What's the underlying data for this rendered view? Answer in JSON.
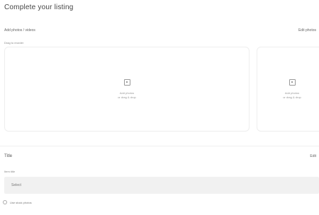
{
  "header": {
    "title": "Complete your listing"
  },
  "photos": {
    "label": "Add photos / videos",
    "action": "Edit photos",
    "hint": "Drag to reorder",
    "cards": [
      {
        "icon": "image-icon",
        "line1": "Add photos",
        "line2": "or drag & drop"
      },
      {
        "icon": "image-icon",
        "line1": "Add photos",
        "line2": "or drag & drop"
      }
    ]
  },
  "title_section": {
    "label": "Title",
    "action": "Edit",
    "hint": "Item title",
    "select_value": "Select"
  },
  "options": {
    "radio_label": "Use stock photos"
  }
}
